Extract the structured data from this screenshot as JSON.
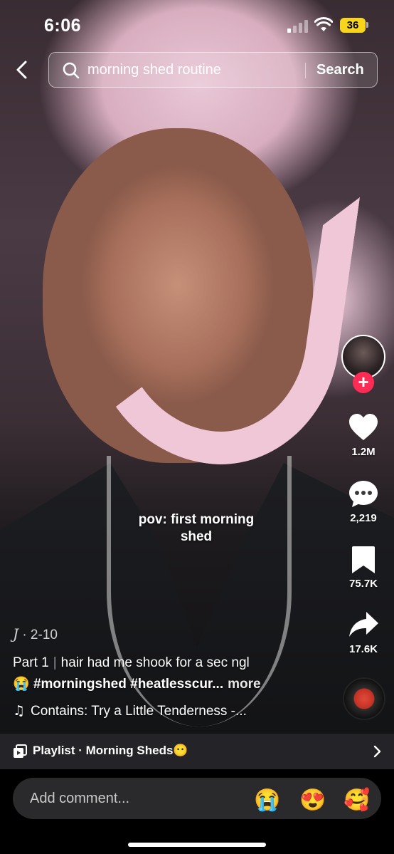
{
  "status_bar": {
    "time": "6:06",
    "battery": "36"
  },
  "search": {
    "query": "morning shed routine",
    "button": "Search"
  },
  "rail": {
    "likes": "1.2M",
    "comments": "2,219",
    "saves": "75.7K",
    "shares": "17.6K"
  },
  "overlay": {
    "text": "pov: first morning shed"
  },
  "post": {
    "author": "J",
    "date": "· 2-10",
    "part": "Part 1",
    "caption": "hair had me shook for a sec ngl",
    "emoji": "😭",
    "hashtags": "#morningshed #heatlesscur...",
    "more": "more",
    "sound": "Contains: Try a Little Tenderness -..."
  },
  "playlist": {
    "label": "Playlist · Morning Sheds😶"
  },
  "comment_bar": {
    "placeholder": "Add comment...",
    "emojis": [
      "😭",
      "😍",
      "🥰"
    ]
  },
  "colors": {
    "accent": "#fe2c55",
    "battery": "#f7d51d"
  }
}
